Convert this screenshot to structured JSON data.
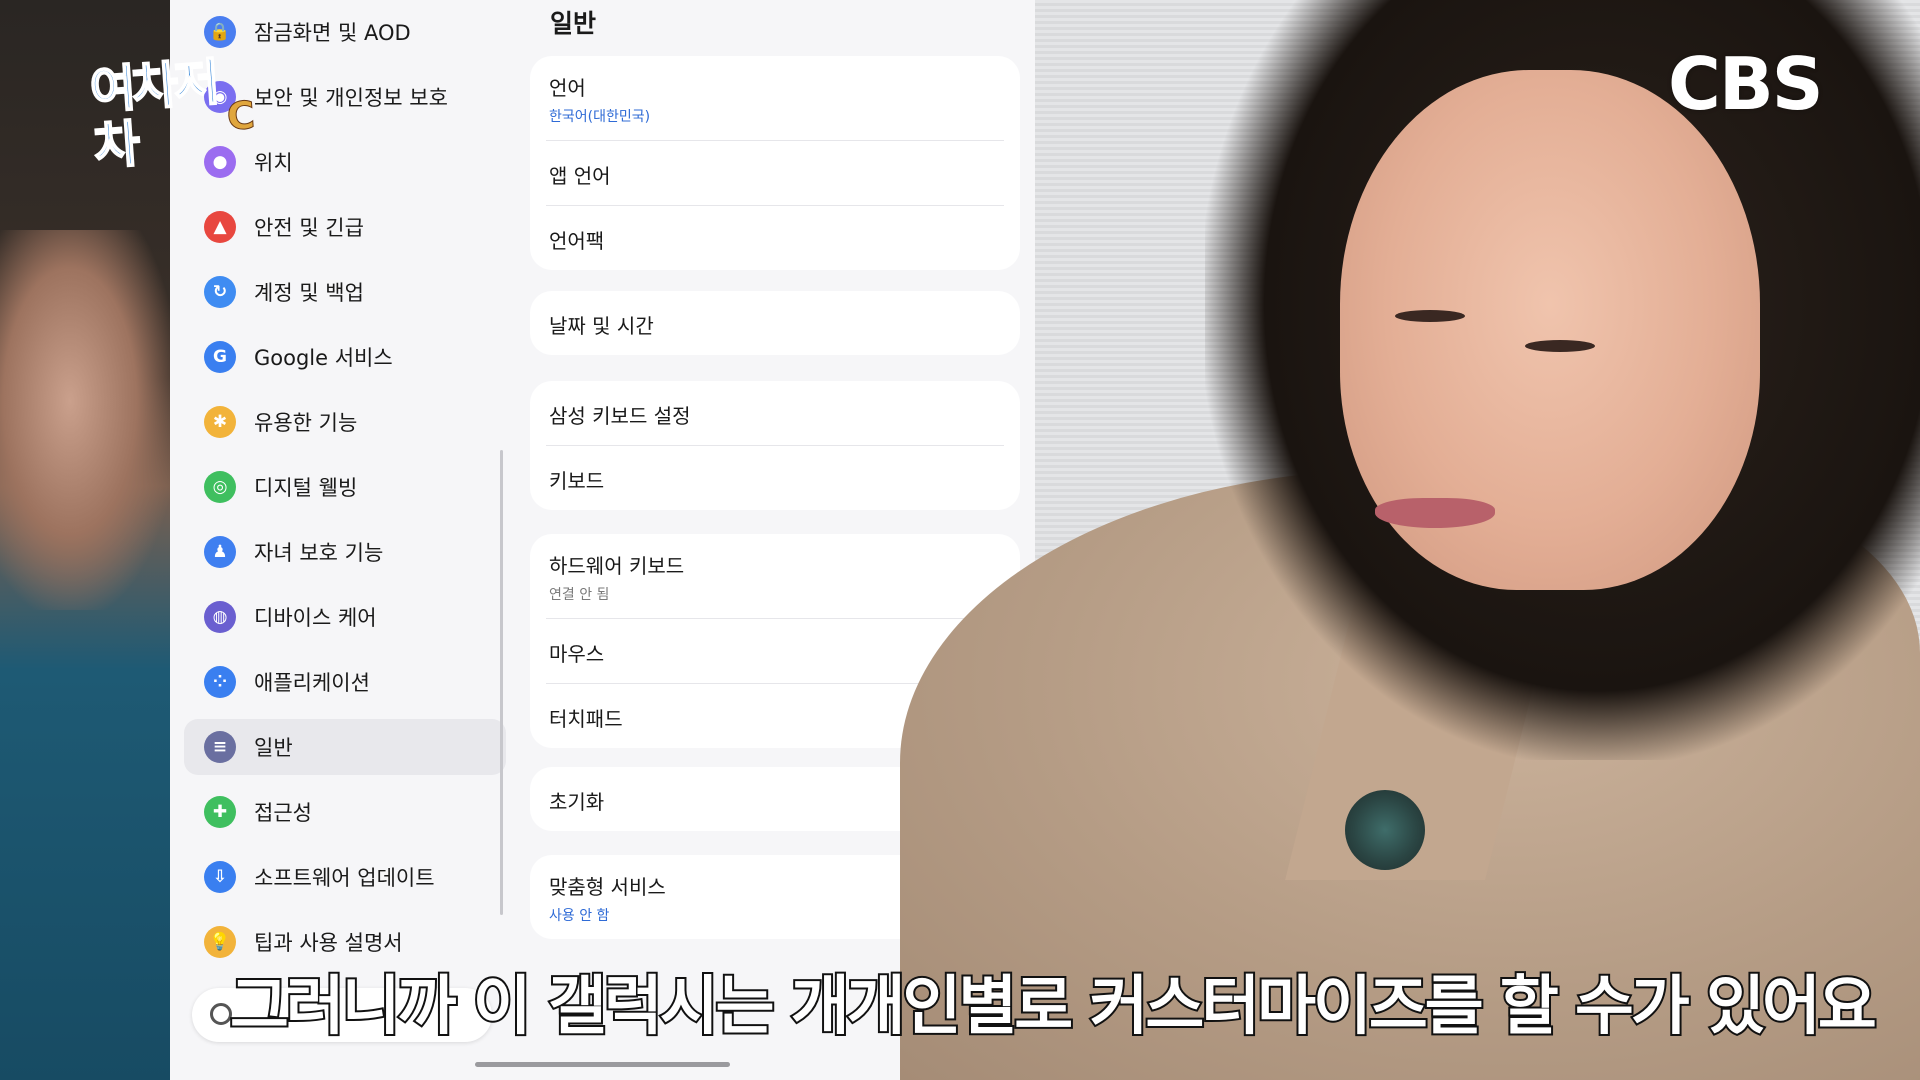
{
  "broadcast": {
    "logo_text": "여차저차",
    "channel": "CBS",
    "caption": "그러니까 이 갤럭시는 개개인별로 커스터마이즈를 할 수가 있어요"
  },
  "sidebar": {
    "items": [
      {
        "label": "잠금화면 및 AOD",
        "icon": "lock-icon",
        "color": "#4a7ef0"
      },
      {
        "label": "보안 및 개인정보 보호",
        "icon": "shield-icon",
        "color": "#7a6ef0"
      },
      {
        "label": "위치",
        "icon": "location-icon",
        "color": "#9b6cf0"
      },
      {
        "label": "안전 및 긴급",
        "icon": "siren-icon",
        "color": "#e8473f"
      },
      {
        "label": "계정 및 백업",
        "icon": "sync-icon",
        "color": "#3f8cf2"
      },
      {
        "label": "Google 서비스",
        "icon": "google-icon",
        "color": "#3a7ff0"
      },
      {
        "label": "유용한 기능",
        "icon": "star-gear-icon",
        "color": "#f2b33a"
      },
      {
        "label": "디지털 웰빙",
        "icon": "wellbeing-icon",
        "color": "#3fbf5f"
      },
      {
        "label": "자녀 보호 기능",
        "icon": "child-icon",
        "color": "#3f7ff0"
      },
      {
        "label": "디바이스 케어",
        "icon": "device-care-icon",
        "color": "#6a5fd0"
      },
      {
        "label": "애플리케이션",
        "icon": "apps-icon",
        "color": "#3a7ff0"
      },
      {
        "label": "일반",
        "icon": "general-icon",
        "color": "#6a6fa0",
        "active": true
      },
      {
        "label": "접근성",
        "icon": "accessibility-icon",
        "color": "#3fbf5f"
      },
      {
        "label": "소프트웨어 업데이트",
        "icon": "update-icon",
        "color": "#3a7ff0"
      },
      {
        "label": "팁과 사용 설명서",
        "icon": "tips-icon",
        "color": "#f2b33a"
      }
    ]
  },
  "general": {
    "title": "일반",
    "groups": [
      [
        {
          "title": "언어",
          "sub": "한국어(대한민국)",
          "sub_color": "blue"
        },
        {
          "title": "앱 언어"
        },
        {
          "title": "언어팩"
        }
      ],
      [
        {
          "title": "날짜 및 시간"
        }
      ],
      [
        {
          "title": "삼성 키보드 설정"
        },
        {
          "title": "키보드"
        }
      ],
      [
        {
          "title": "하드웨어 키보드",
          "sub": "연결 안 됨",
          "sub_color": "gray"
        },
        {
          "title": "마우스"
        },
        {
          "title": "터치패드"
        }
      ],
      [
        {
          "title": "초기화"
        }
      ],
      [
        {
          "title": "맞춤형 서비스",
          "sub": "사용 안 함",
          "sub_color": "blue"
        }
      ]
    ]
  }
}
